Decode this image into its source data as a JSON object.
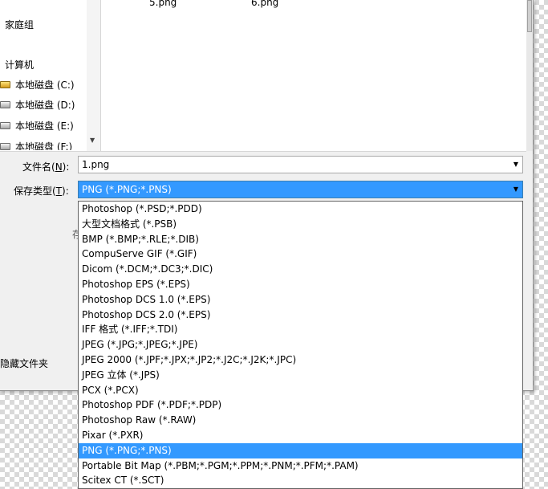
{
  "nav": {
    "homegroup": "家庭组",
    "computer": "计算机",
    "drives": [
      "本地磁盘 (C:)",
      "本地磁盘 (D:)",
      "本地磁盘 (E:)",
      "本地磁盘 (F:)"
    ]
  },
  "files": [
    "5.png",
    "6.png"
  ],
  "filename": {
    "label_main": "文件名(",
    "label_key": "N",
    "label_end": "):",
    "value": "1.png"
  },
  "savetype": {
    "label_main": "保存类型(",
    "label_key": "T",
    "label_end": "):",
    "value": "PNG (*.PNG;*.PNS)"
  },
  "partial_text": "存",
  "hide_folders": "隐藏文件夹",
  "dropdown": {
    "selected_index": 16,
    "options": [
      "Photoshop (*.PSD;*.PDD)",
      "大型文档格式 (*.PSB)",
      "BMP (*.BMP;*.RLE;*.DIB)",
      "CompuServe GIF (*.GIF)",
      "Dicom (*.DCM;*.DC3;*.DIC)",
      "Photoshop EPS (*.EPS)",
      "Photoshop DCS 1.0 (*.EPS)",
      "Photoshop DCS 2.0 (*.EPS)",
      "IFF 格式 (*.IFF;*.TDI)",
      "JPEG (*.JPG;*.JPEG;*.JPE)",
      "JPEG 2000 (*.JPF;*.JPX;*.JP2;*.J2C;*.J2K;*.JPC)",
      "JPEG 立体 (*.JPS)",
      "PCX (*.PCX)",
      "Photoshop PDF (*.PDF;*.PDP)",
      "Photoshop Raw (*.RAW)",
      "Pixar (*.PXR)",
      "PNG (*.PNG;*.PNS)",
      "Portable Bit Map (*.PBM;*.PGM;*.PPM;*.PNM;*.PFM;*.PAM)",
      "Scitex CT (*.SCT)"
    ]
  },
  "colors": {
    "selection": "#3399ff",
    "dialog_bg": "#f0f0f0"
  }
}
